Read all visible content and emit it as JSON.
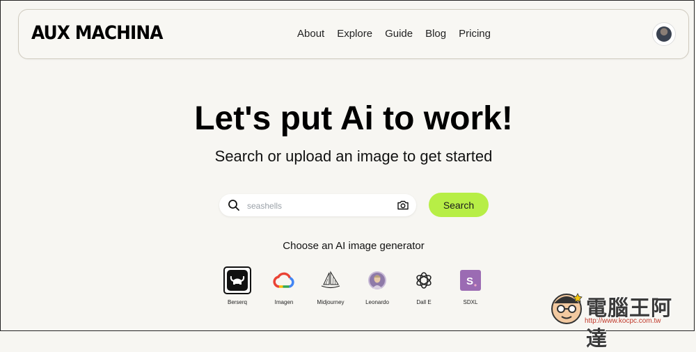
{
  "brand": {
    "logo": "AUX MACHINA"
  },
  "nav": {
    "links": [
      "About",
      "Explore",
      "Guide",
      "Blog",
      "Pricing"
    ]
  },
  "hero": {
    "title": "Let's put Ai to work!",
    "subtitle": "Search or upload an image to get started"
  },
  "search": {
    "placeholder": "seashells",
    "value": "",
    "button_label": "Search"
  },
  "generators": {
    "label": "Choose an AI image generator",
    "selected": "Berserq",
    "items": [
      {
        "name": "Berserq",
        "icon": "berserq-icon"
      },
      {
        "name": "Imagen",
        "icon": "google-cloud-icon"
      },
      {
        "name": "Midjourney",
        "icon": "midjourney-sailboat-icon"
      },
      {
        "name": "Leonardo",
        "icon": "leonardo-portrait-icon"
      },
      {
        "name": "Dall E",
        "icon": "openai-icon"
      },
      {
        "name": "SDXL",
        "icon": "sdxl-icon"
      }
    ]
  },
  "watermark": {
    "text": "電腦王阿達",
    "url": "http://www.kocpc.com.tw"
  },
  "colors": {
    "background": "#f7f6f2",
    "accent": "#b7ee46",
    "sdxl": "#9b6bb3"
  }
}
